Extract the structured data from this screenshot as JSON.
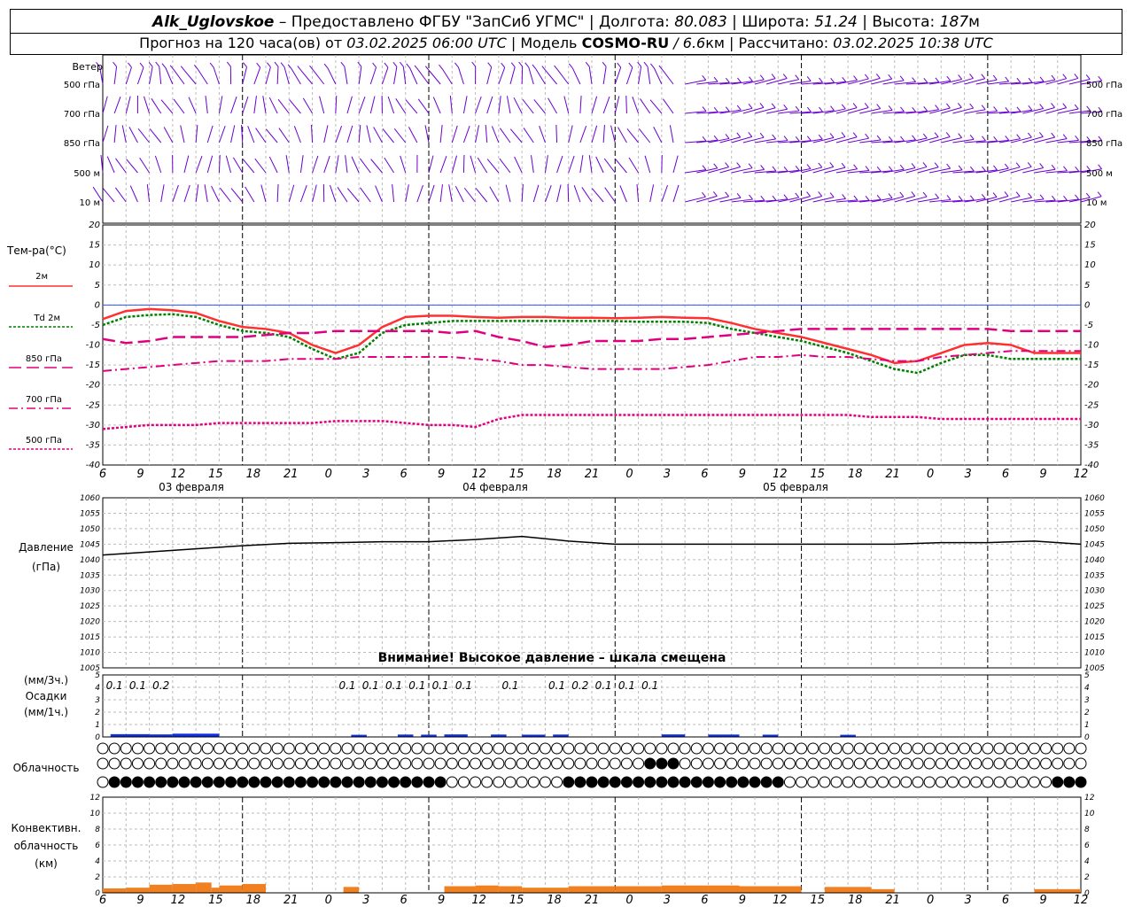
{
  "header": {
    "station": "Alk_Uglovskoe",
    "provider": " – Предоставлено ФГБУ \"ЗапСиб УГМС\" | ",
    "lon_label": "Долгота: ",
    "lon": "80.083",
    "lat_label": " | Широта: ",
    "lat": "51.24",
    "alt_label": " | Высота: ",
    "alt": "187",
    "alt_unit": "м",
    "forecast_label": "Прогноз на 120 часа(ов) от ",
    "forecast_start": "03.02.2025 06:00 UTC",
    "model_label": " | Модель ",
    "model": "COSMO-RU",
    "model_res": " / 6.6",
    "model_res_unit": "км",
    "calc_label": " | Рассчитано: ",
    "calc_time": "03.02.2025 10:38 UTC"
  },
  "labels": {
    "wind_title": "Ветер",
    "wind_levels": [
      "500 гПа",
      "700 гПа",
      "850 гПа",
      "500 м",
      "10  м"
    ],
    "temp_title": "Тем-ра(°С)",
    "legend": [
      "2м",
      "Td  2м",
      "850 гПа",
      "700 гПа",
      "500 гПа"
    ],
    "pressure_title": "Давление",
    "pressure_unit": "(гПа)",
    "pressure_warning": "Внимание! Высокое давление – шкала смещена",
    "precip_unit_3h": "(мм/3ч.)",
    "precip_title": "Осадки",
    "precip_unit_1h": "(мм/1ч.)",
    "cloud_title": "Облачность",
    "conv_title1": "Конвективн.",
    "conv_title2": "облачность",
    "conv_unit": "(км)",
    "dates": [
      "03 февраля",
      "04 февраля",
      "05 февраля"
    ]
  },
  "colors": {
    "t2m": "#ff3030",
    "td2m": "#008000",
    "t850": "#e0007f",
    "t700": "#e0007f",
    "t500": "#e0007f",
    "wind": "#6a00d0",
    "precip": "#1030e0",
    "conv": "#f08020",
    "pressure": "#000000"
  },
  "chart_data": [
    {
      "type": "line",
      "title": "Тем-ра(°С)",
      "x_hours": [
        0,
        3,
        6,
        9,
        12,
        15,
        18,
        21,
        24,
        27,
        30,
        33,
        36,
        39,
        42,
        45,
        48,
        51,
        54,
        57,
        60,
        63,
        66,
        69,
        72,
        75,
        78,
        81,
        84,
        87,
        90,
        93,
        96,
        99,
        102,
        105,
        108,
        111,
        114,
        117,
        120,
        123,
        126
      ],
      "x_tick_labels": [
        "6",
        "9",
        "12",
        "15",
        "18",
        "21",
        "0",
        "3",
        "6",
        "9",
        "12",
        "15",
        "18",
        "21",
        "0",
        "3",
        "6",
        "9",
        "12",
        "15",
        "18",
        "21",
        "0",
        "3",
        "6",
        "9",
        "12"
      ],
      "ylim": [
        -40,
        20
      ],
      "series": [
        {
          "name": "2м",
          "values": [
            -3.5,
            -1.5,
            -1,
            -1.3,
            -2,
            -4,
            -5.5,
            -6,
            -7,
            -10,
            -12,
            -10,
            -5.5,
            -3,
            -2.7,
            -2.7,
            -3,
            -3.2,
            -3,
            -3,
            -3.2,
            -3.2,
            -3.3,
            -3.2,
            -3,
            -3.2,
            -3.3,
            -4.5,
            -6,
            -7,
            -8,
            -9.5,
            -11,
            -12.5,
            -14.5,
            -14,
            -12,
            -10,
            -9.5,
            -10,
            -12,
            -12,
            -12
          ]
        },
        {
          "name": "Td  2м",
          "values": [
            -5,
            -3,
            -2.5,
            -2.3,
            -3,
            -5,
            -6.5,
            -7,
            -8,
            -11,
            -13.5,
            -12,
            -7,
            -5,
            -4.5,
            -4,
            -4,
            -4,
            -4,
            -4,
            -4,
            -4,
            -4,
            -4.2,
            -4.2,
            -4.2,
            -4.5,
            -6,
            -7,
            -8,
            -9,
            -10.5,
            -12,
            -14,
            -16,
            -17,
            -14.5,
            -12.5,
            -12.5,
            -13.5,
            -13.5,
            -13.5,
            -13.5
          ]
        },
        {
          "name": "850 гПа",
          "values": [
            -8.5,
            -9.5,
            -9,
            -8,
            -8,
            -8,
            -8,
            -7.5,
            -7,
            -7,
            -6.5,
            -6.5,
            -6.5,
            -6.5,
            -6.5,
            -7,
            -6.5,
            -8,
            -9,
            -10.5,
            -10,
            -9,
            -9,
            -9,
            -8.5,
            -8.5,
            -8,
            -7.5,
            -7,
            -6.5,
            -6,
            -6,
            -6,
            -6,
            -6,
            -6,
            -6,
            -6,
            -6,
            -6.5,
            -6.5,
            -6.5,
            -6.5
          ]
        },
        {
          "name": "700 гПа",
          "values": [
            -16.5,
            -16,
            -15.5,
            -15,
            -14.5,
            -14,
            -14,
            -14,
            -13.5,
            -13.5,
            -13.5,
            -13,
            -13,
            -13,
            -13,
            -13,
            -13.5,
            -14,
            -15,
            -15,
            -15.5,
            -16,
            -16,
            -16,
            -16,
            -15.5,
            -15,
            -14,
            -13,
            -13,
            -12.5,
            -13,
            -13,
            -13.5,
            -14,
            -14,
            -13,
            -12.5,
            -12,
            -11.5,
            -11.5,
            -11.5,
            -11.5
          ]
        },
        {
          "name": "500 гПа",
          "values": [
            -31,
            -30.5,
            -30,
            -30,
            -30,
            -29.5,
            -29.5,
            -29.5,
            -29.5,
            -29.5,
            -29,
            -29,
            -29,
            -29.5,
            -30,
            -30,
            -30.5,
            -28.5,
            -27.5,
            -27.5,
            -27.5,
            -27.5,
            -27.5,
            -27.5,
            -27.5,
            -27.5,
            -27.5,
            -27.5,
            -27.5,
            -27.5,
            -27.5,
            -27.5,
            -27.5,
            -28,
            -28,
            -28,
            -28.5,
            -28.5,
            -28.5,
            -28.5,
            -28.5,
            -28.5,
            -28.5
          ]
        }
      ]
    },
    {
      "type": "line",
      "title": "Давление",
      "ylabel": "(гПа)",
      "ylim": [
        1005,
        1060
      ],
      "x_hours": [
        0,
        6,
        12,
        18,
        24,
        30,
        36,
        42,
        48,
        54,
        60,
        66,
        72,
        78,
        84,
        90,
        96,
        102,
        108,
        114,
        120,
        126
      ],
      "series": [
        {
          "name": "Давление",
          "values": [
            1041.5,
            1042.5,
            1043.5,
            1044.5,
            1045.3,
            1045.5,
            1045.8,
            1045.8,
            1046.5,
            1047.5,
            1046,
            1045,
            1045,
            1045,
            1045,
            1045,
            1045,
            1045,
            1045.5,
            1045.5,
            1046,
            1045
          ]
        }
      ]
    },
    {
      "type": "bar",
      "title": "Осадки",
      "ylim": [
        0,
        5
      ],
      "labels_3h": [
        {
          "h": 0,
          "v": "0.1"
        },
        {
          "h": 3,
          "v": "0.1"
        },
        {
          "h": 6,
          "v": "0.2"
        },
        {
          "h": 30,
          "v": "0.1"
        },
        {
          "h": 33,
          "v": "0.1"
        },
        {
          "h": 36,
          "v": "0.1"
        },
        {
          "h": 39,
          "v": "0.1"
        },
        {
          "h": 42,
          "v": "0.1"
        },
        {
          "h": 45,
          "v": "0.1"
        },
        {
          "h": 51,
          "v": "0.1"
        },
        {
          "h": 57,
          "v": "0.1"
        },
        {
          "h": 60,
          "v": "0.2"
        },
        {
          "h": 63,
          "v": "0.1"
        },
        {
          "h": 66,
          "v": "0.1"
        },
        {
          "h": 69,
          "v": "0.1"
        }
      ],
      "bars_1h": [
        {
          "start": 1,
          "end": 6,
          "v": 0.08
        },
        {
          "start": 6,
          "end": 9,
          "v": 0.06
        },
        {
          "start": 9,
          "end": 15,
          "v": 0.12
        },
        {
          "start": 32,
          "end": 34,
          "v": 0.03
        },
        {
          "start": 38,
          "end": 40,
          "v": 0.05
        },
        {
          "start": 41,
          "end": 43,
          "v": 0.04
        },
        {
          "start": 44,
          "end": 47,
          "v": 0.06
        },
        {
          "start": 50,
          "end": 52,
          "v": 0.05
        },
        {
          "start": 54,
          "end": 57,
          "v": 0.04
        },
        {
          "start": 58,
          "end": 60,
          "v": 0.05
        },
        {
          "start": 72,
          "end": 75,
          "v": 0.06
        },
        {
          "start": 78,
          "end": 82,
          "v": 0.05
        },
        {
          "start": 85,
          "end": 87,
          "v": 0.04
        },
        {
          "start": 95,
          "end": 97,
          "v": 0.03
        }
      ]
    },
    {
      "type": "bar",
      "title": "Конвективн. облачность",
      "ylabel": "(км)",
      "ylim": [
        0,
        13
      ],
      "bars": [
        {
          "start": 0,
          "end": 3,
          "v": 0.6
        },
        {
          "start": 3,
          "end": 6,
          "v": 0.7
        },
        {
          "start": 6,
          "end": 9,
          "v": 1.1
        },
        {
          "start": 9,
          "end": 12,
          "v": 1.2
        },
        {
          "start": 12,
          "end": 14,
          "v": 1.4
        },
        {
          "start": 14,
          "end": 15,
          "v": 0.7
        },
        {
          "start": 15,
          "end": 18,
          "v": 1.0
        },
        {
          "start": 18,
          "end": 21,
          "v": 1.2
        },
        {
          "start": 31,
          "end": 33,
          "v": 0.8
        },
        {
          "start": 44,
          "end": 48,
          "v": 0.9
        },
        {
          "start": 48,
          "end": 51,
          "v": 1.0
        },
        {
          "start": 51,
          "end": 54,
          "v": 0.9
        },
        {
          "start": 54,
          "end": 60,
          "v": 0.7
        },
        {
          "start": 60,
          "end": 66,
          "v": 0.9
        },
        {
          "start": 66,
          "end": 72,
          "v": 0.9
        },
        {
          "start": 72,
          "end": 78,
          "v": 1.0
        },
        {
          "start": 78,
          "end": 82,
          "v": 1.0
        },
        {
          "start": 82,
          "end": 90,
          "v": 0.9
        },
        {
          "start": 93,
          "end": 99,
          "v": 0.8
        },
        {
          "start": 99,
          "end": 102,
          "v": 0.5
        },
        {
          "start": 120,
          "end": 126,
          "v": 0.5
        }
      ]
    }
  ]
}
